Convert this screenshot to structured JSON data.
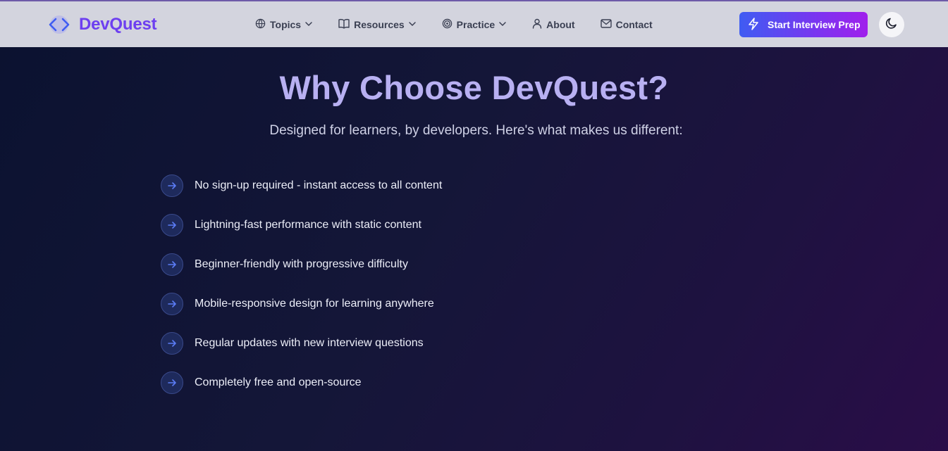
{
  "brand": {
    "name": "DevQuest",
    "icon": "code-brackets-icon"
  },
  "nav": {
    "items": [
      {
        "label": "Topics",
        "icon": "globe-icon",
        "dropdown": true
      },
      {
        "label": "Resources",
        "icon": "book-icon",
        "dropdown": true
      },
      {
        "label": "Practice",
        "icon": "target-icon",
        "dropdown": true
      },
      {
        "label": "About",
        "icon": "user-icon",
        "dropdown": false
      },
      {
        "label": "Contact",
        "icon": "mail-icon",
        "dropdown": false
      }
    ],
    "cta_label": "Start Interview Prep",
    "cta_icon": "lightning-icon",
    "theme_icon": "moon-icon"
  },
  "hero": {
    "title": "Why Choose DevQuest?",
    "subtitle": "Designed for learners, by developers. Here's what makes us different:"
  },
  "features": [
    "No sign-up required - instant access to all content",
    "Lightning-fast performance with static content",
    "Beginner-friendly with progressive difficulty",
    "Mobile-responsive design for learning anywhere",
    "Regular updates with new interview questions",
    "Completely free and open-source"
  ],
  "colors": {
    "brand": "#6d3ff0",
    "navbar_bg": "#d3d4de",
    "cta_start": "#3f5cf2",
    "cta_end": "#a020ec",
    "title": "#b8b0f2",
    "feature_icon": "#5b7cf5"
  }
}
